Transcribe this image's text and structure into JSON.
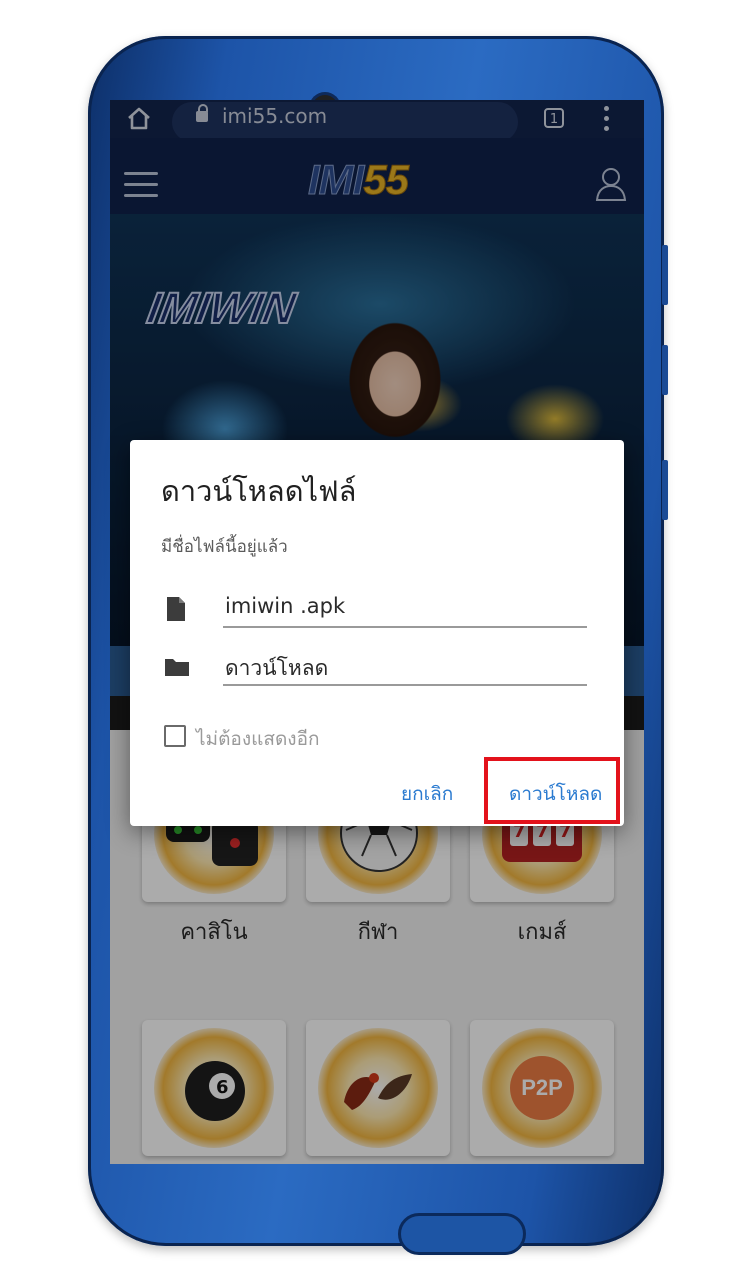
{
  "browser": {
    "url": "imi55.com",
    "tab_count": "1"
  },
  "site": {
    "logo_part1": "IMI",
    "logo_part2": "55",
    "banner_brand": "IMIWIN"
  },
  "games": [
    {
      "label": "คาสิโน",
      "icon": "dice-icon"
    },
    {
      "label": "กีฬา",
      "icon": "soccer-ball-icon"
    },
    {
      "label": "เกมส์",
      "icon": "slot-machine-icon"
    },
    {
      "label": "",
      "icon": "lottery-ball-icon"
    },
    {
      "label": "",
      "icon": "cockfight-icon"
    },
    {
      "label": "P2P",
      "icon": "p2p-icon"
    }
  ],
  "dialog": {
    "title": "ดาวน์โหลดไฟล์",
    "subtitle": "มีชื่อไฟล์นี้อยู่แล้ว",
    "filename": "imiwin     .apk",
    "folder": "ดาวน์โหลด",
    "checkbox_label": "ไม่ต้องแสดงอีก",
    "checkbox_checked": false,
    "cancel_label": "ยกเลิก",
    "download_label": "ดาวน์โหลด",
    "accent_color": "#2b7bd0",
    "highlight_color": "#e3121b"
  }
}
